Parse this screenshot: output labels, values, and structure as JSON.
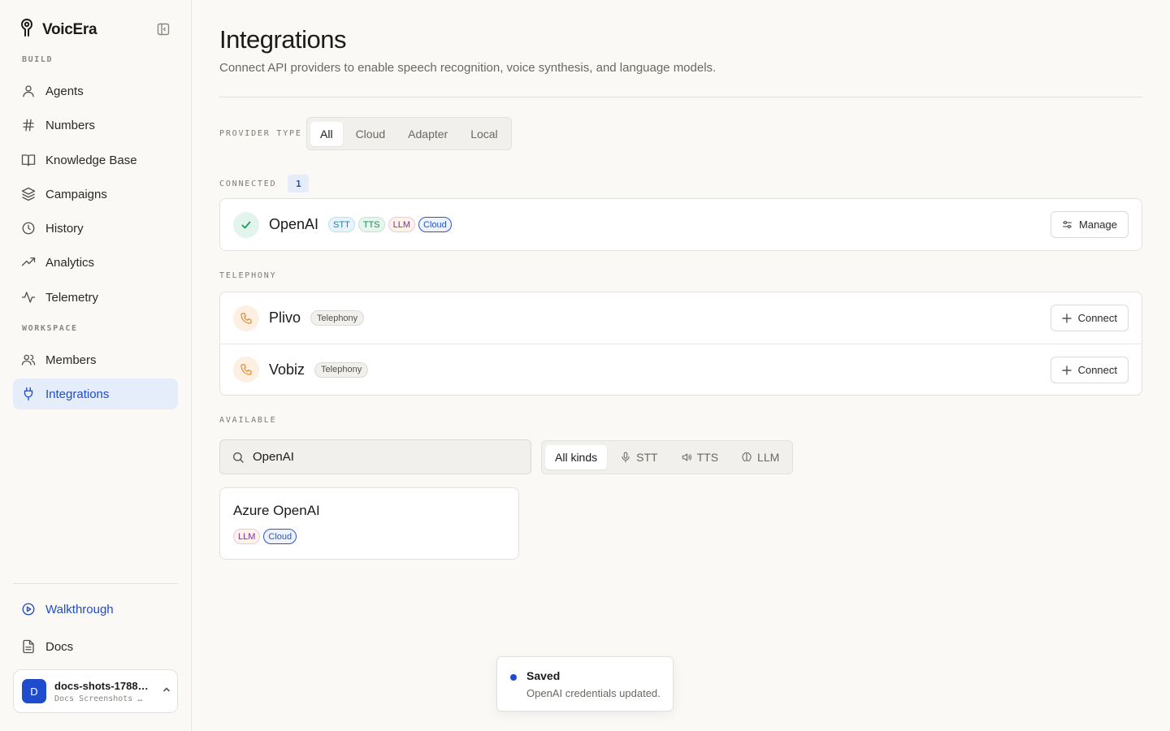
{
  "app": {
    "name": "VoicEra"
  },
  "sidebar": {
    "sections": [
      {
        "label": "BUILD"
      },
      {
        "label": "WORKSPACE"
      }
    ],
    "build_items": [
      {
        "label": "Agents",
        "icon": "user-icon"
      },
      {
        "label": "Numbers",
        "icon": "hash-icon"
      },
      {
        "label": "Knowledge Base",
        "icon": "book-icon"
      },
      {
        "label": "Campaigns",
        "icon": "layers-icon"
      },
      {
        "label": "History",
        "icon": "clock-icon"
      },
      {
        "label": "Analytics",
        "icon": "trending-up-icon"
      },
      {
        "label": "Telemetry",
        "icon": "activity-icon"
      }
    ],
    "workspace_items": [
      {
        "label": "Members",
        "icon": "users-icon"
      },
      {
        "label": "Integrations",
        "icon": "plug-icon",
        "active": true
      }
    ],
    "footer_items": [
      {
        "label": "Walkthrough",
        "icon": "play-circle-icon"
      },
      {
        "label": "Docs",
        "icon": "file-text-icon"
      }
    ],
    "account": {
      "initial": "D",
      "name": "docs-shots-1788…",
      "subtitle": "Docs Screenshots …"
    }
  },
  "page": {
    "title": "Integrations",
    "subtitle": "Connect API providers to enable speech recognition, voice synthesis, and language models."
  },
  "provider_type": {
    "label": "PROVIDER TYPE",
    "options": [
      "All",
      "Cloud",
      "Adapter",
      "Local"
    ],
    "selected": "All"
  },
  "connected": {
    "label": "CONNECTED",
    "count": "1",
    "items": [
      {
        "name": "OpenAI",
        "tags": [
          "STT",
          "TTS",
          "LLM",
          "Cloud"
        ],
        "action": "Manage"
      }
    ]
  },
  "telephony": {
    "label": "TELEPHONY",
    "items": [
      {
        "name": "Plivo",
        "tag": "Telephony",
        "action": "Connect"
      },
      {
        "name": "Vobiz",
        "tag": "Telephony",
        "action": "Connect"
      }
    ]
  },
  "available": {
    "label": "AVAILABLE",
    "search_value": "OpenAI",
    "kind_options": [
      "All kinds",
      "STT",
      "TTS",
      "LLM"
    ],
    "kind_selected": "All kinds",
    "results": [
      {
        "name": "Azure OpenAI",
        "tags": [
          "LLM",
          "Cloud"
        ]
      }
    ]
  },
  "toast": {
    "title": "Saved",
    "message": "OpenAI credentials updated."
  },
  "colors": {
    "accent": "#1f4ccf",
    "success": "#1e9a5d",
    "telephony": "#e08a2c",
    "background": "#faf9f6"
  }
}
